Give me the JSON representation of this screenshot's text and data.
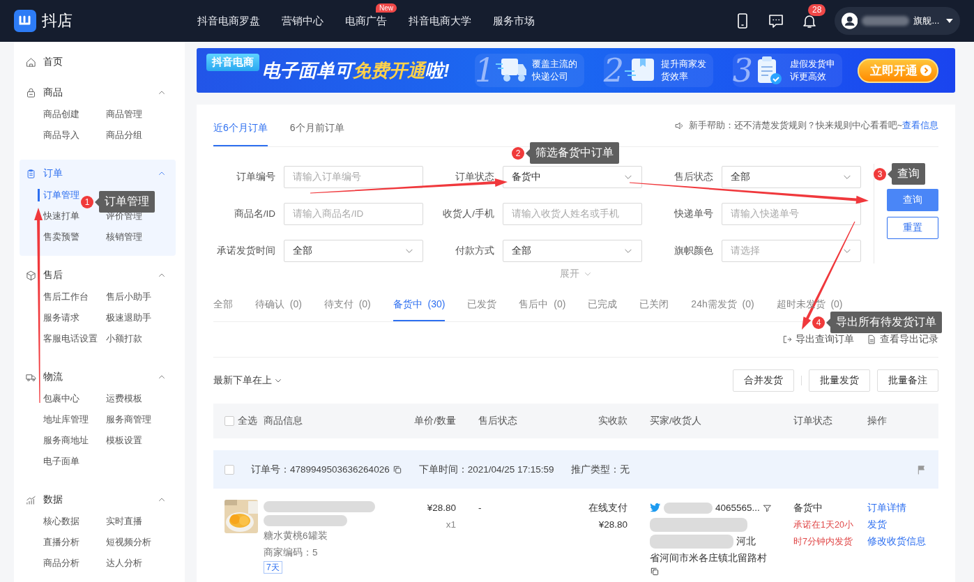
{
  "topbar": {
    "logo_text": "抖店",
    "nav": [
      {
        "label": "抖音电商罗盘"
      },
      {
        "label": "营销中心"
      },
      {
        "label": "电商广告",
        "badge": "New"
      },
      {
        "label": "抖音电商大学"
      },
      {
        "label": "服务市场"
      }
    ],
    "notification_count": "28",
    "user_name": "旗舰..."
  },
  "sidebar": {
    "groups": [
      {
        "label": "首页",
        "expanded": false,
        "selected": false
      },
      {
        "label": "商品",
        "expanded": true,
        "selected": false,
        "items": [
          {
            "label": "商品创建",
            "kind": "link",
            "selected": false
          },
          {
            "label": "商品管理",
            "kind": "link",
            "selected": false
          },
          {
            "label": "商品导入",
            "kind": "link",
            "selected": false
          },
          {
            "label": "商品分组",
            "kind": "link",
            "selected": false
          }
        ]
      },
      {
        "label": "订单",
        "expanded": true,
        "selected": true,
        "items": [
          {
            "label": "订单管理",
            "kind": "link",
            "selected": true
          },
          {
            "kind": "covered"
          },
          {
            "label": "快速打单",
            "kind": "link",
            "selected": false
          },
          {
            "label": "评价管理",
            "kind": "link",
            "selected": false
          },
          {
            "label": "售卖预警",
            "kind": "link",
            "selected": false
          },
          {
            "label": "核销管理",
            "kind": "link",
            "selected": false
          }
        ]
      },
      {
        "label": "售后",
        "expanded": true,
        "selected": false,
        "items": [
          {
            "label": "售后工作台",
            "kind": "link",
            "selected": false
          },
          {
            "label": "售后小助手",
            "kind": "link",
            "selected": false
          },
          {
            "label": "服务请求",
            "kind": "link",
            "selected": false
          },
          {
            "label": "极速退助手",
            "kind": "link",
            "selected": false
          },
          {
            "label": "客服电话设置",
            "kind": "link",
            "selected": false
          },
          {
            "label": "小额打款",
            "kind": "link",
            "selected": false
          }
        ]
      },
      {
        "label": "物流",
        "expanded": true,
        "selected": false,
        "items": [
          {
            "label": "包裹中心",
            "kind": "link",
            "selected": false
          },
          {
            "label": "运费模板",
            "kind": "link",
            "selected": false
          },
          {
            "label": "地址库管理",
            "kind": "link",
            "selected": false
          },
          {
            "label": "服务商管理",
            "kind": "link",
            "selected": false
          },
          {
            "label": "服务商地址",
            "kind": "link",
            "selected": false
          },
          {
            "label": "模板设置",
            "kind": "link",
            "selected": false
          },
          {
            "label": "电子面单",
            "kind": "link",
            "selected": false
          }
        ]
      },
      {
        "label": "数据",
        "expanded": true,
        "selected": false,
        "items": [
          {
            "label": "核心数据",
            "kind": "link",
            "selected": false
          },
          {
            "label": "实时直播",
            "kind": "link",
            "selected": false
          },
          {
            "label": "直播分析",
            "kind": "link",
            "selected": false
          },
          {
            "label": "短视频分析",
            "kind": "link",
            "selected": false
          },
          {
            "label": "商品分析",
            "kind": "link",
            "selected": false
          },
          {
            "label": "达人分析",
            "kind": "link",
            "selected": false
          }
        ]
      }
    ]
  },
  "banner": {
    "tag": "抖音电商",
    "title_parts": [
      {
        "text": "电子面单可",
        "highlight": false
      },
      {
        "text": "免费开通",
        "highlight": true
      },
      {
        "text": "啦!",
        "highlight": false
      }
    ],
    "steps": [
      {
        "number": "1",
        "text": "覆盖主流的快递公司"
      },
      {
        "number": "2",
        "text": "提升商家发货效率"
      },
      {
        "number": "3",
        "text": "虚假发货申诉更高效"
      }
    ],
    "button": "立即开通"
  },
  "range_tabs": [
    {
      "label": "近6个月订单",
      "selected": true
    },
    {
      "label": "6个月前订单",
      "selected": false
    }
  ],
  "help": {
    "text": "新手帮助：还不清楚发货规则？快来规则中心看看吧~",
    "link": "查看信息"
  },
  "filters": [
    {
      "label": "订单编号",
      "kind": "input",
      "placeholder": "请输入订单编号"
    },
    {
      "label": "订单状态",
      "kind": "select",
      "value": "备货中"
    },
    {
      "label": "售后状态",
      "kind": "select",
      "value": "全部"
    },
    {
      "label": "商品名/ID",
      "kind": "input",
      "placeholder": "请输入商品名/ID"
    },
    {
      "label": "收货人/手机",
      "kind": "input",
      "placeholder": "请输入收货人姓名或手机"
    },
    {
      "label": "快递单号",
      "kind": "input",
      "placeholder": "请输入快递单号"
    },
    {
      "label": "承诺发货时间",
      "kind": "select",
      "value": "全部"
    },
    {
      "label": "付款方式",
      "kind": "select",
      "value": "全部"
    },
    {
      "label": "旗帜颜色",
      "kind": "select",
      "placeholder": "请选择"
    }
  ],
  "query_button": "查询",
  "reset_button": "重置",
  "expand_toggle": "展开",
  "status_tabs": [
    {
      "label": "全部",
      "selected": false
    },
    {
      "label": "待确认  (0)",
      "selected": false
    },
    {
      "label": "待支付  (0)",
      "selected": false
    },
    {
      "label": "备货中  (30)",
      "selected": true
    },
    {
      "label": "已发货",
      "selected": false
    },
    {
      "label": "售后中  (0)",
      "selected": false
    },
    {
      "label": "已完成",
      "selected": false
    },
    {
      "label": "已关闭",
      "selected": false
    },
    {
      "label": "24h需发货  (0)",
      "selected": false
    },
    {
      "label": "超时未发货  (0)",
      "selected": false
    }
  ],
  "export_links": [
    {
      "label": "导出查询订单",
      "kind": "export"
    },
    {
      "label": "查看导出记录",
      "kind": "record"
    }
  ],
  "sort": "最新下单在上",
  "batch_buttons": [
    "合并发货",
    "批量发货",
    "批量备注"
  ],
  "table": {
    "select_all": {
      "label": "全选",
      "checked": false
    },
    "columns": [
      "商品信息",
      "单价/数量",
      "售后状态",
      "实收款",
      "买家/收货人",
      "订单状态",
      "操作"
    ]
  },
  "order": {
    "checked": false,
    "order_no": "订单号：4789949503636264026",
    "time": "下单时间：2021/04/25 17:15:59",
    "promo": "推广类型：无",
    "product": {
      "kind": "picture",
      "name": "糖水黄桃6罐装",
      "code": "商家编码：5",
      "tag": "7天"
    },
    "price": "¥28.80",
    "quantity": "x1",
    "after_sale": "-",
    "pay_method": "在线支付",
    "paid": "¥28.80",
    "buyer": {
      "id_fragment": "4065565...",
      "address_end": "河北",
      "address_line": "省河间市米各庄镇北留路村"
    },
    "status": "备货中",
    "deadline": "承诺在1天20小时7分钟内发货",
    "actions": [
      "订单详情",
      "发货",
      "修改收货信息"
    ]
  },
  "annotations": [
    {
      "number": "1",
      "text": "订单管理"
    },
    {
      "number": "2",
      "text": "筛选备货中订单"
    },
    {
      "number": "3",
      "text": "查询"
    },
    {
      "number": "4",
      "text": "导出所有待发货订单"
    }
  ]
}
